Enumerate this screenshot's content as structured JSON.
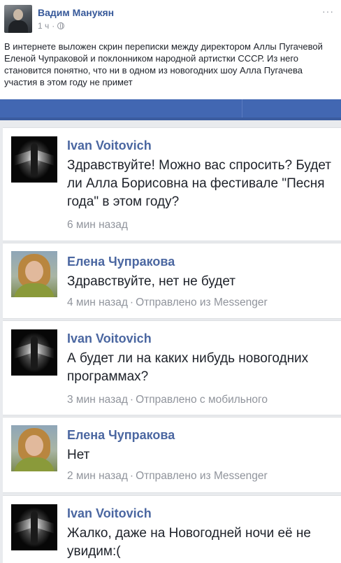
{
  "post": {
    "author": "Вадим Манукян",
    "time": "1 ч",
    "dot": "·",
    "text": "В интернете выложен скрин переписки между директором Аллы Пугачевой Еленой Чупраковой и поклонником народной артистки СССР. Из него становится понятно, что ни в одном из новогодних шоу Алла Пугачева участия в этом году не примет"
  },
  "messages": [
    {
      "name": "Ivan Voitovich",
      "text": "Здравствуйте! Можно вас спросить? Будет ли Алла Борисовна на фестивале \"Песня года\" в этом году?",
      "time": "6 мин назад",
      "sep": "",
      "source": ""
    },
    {
      "name": "Елена Чупракова",
      "text": "Здравствуйте, нет не будет",
      "time": "4 мин назад",
      "sep": "·",
      "source": "Отправлено из Messenger"
    },
    {
      "name": "Ivan Voitovich",
      "text": "А будет ли на каких нибудь новогодних программах?",
      "time": "3 мин назад",
      "sep": "·",
      "source": "Отправлено с мобильного"
    },
    {
      "name": "Елена Чупракова",
      "text": "Нет",
      "time": "2 мин назад",
      "sep": "·",
      "source": "Отправлено из Messenger"
    },
    {
      "name": "Ivan Voitovich",
      "text": "Жалко, даже на Новогодней ночи её не увидим:(",
      "time": "",
      "sep": "",
      "source": ""
    }
  ],
  "icons": {
    "more": "more-options-icon",
    "globe": "globe-icon"
  },
  "colors": {
    "facebook_blue": "#4267b2",
    "name_blue": "#4b67a1",
    "link_blue": "#365899",
    "meta_gray": "#90949c"
  }
}
